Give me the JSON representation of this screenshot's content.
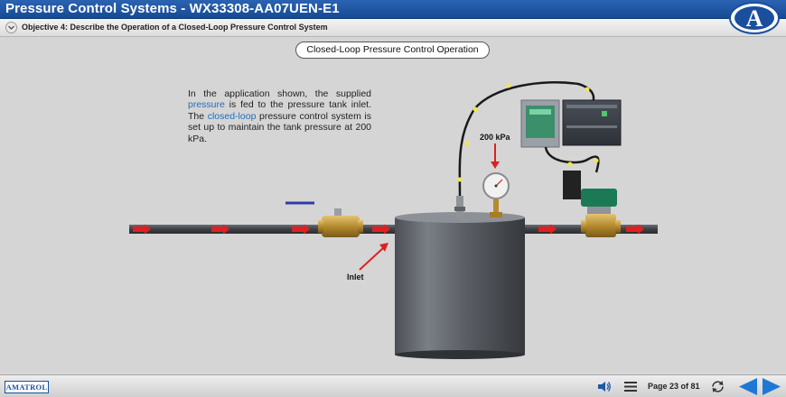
{
  "window": {
    "title": "Pressure Control Systems - WX33308-AA07UEN-E1",
    "logo_letter": "A"
  },
  "objective": {
    "text": "Objective 4: Describe the Operation of a Closed-Loop Pressure Control System"
  },
  "content": {
    "section_title": "Closed-Loop Pressure Control Operation",
    "description": {
      "part1": "In the application shown, the supplied ",
      "link1": "pressure",
      "part2": " is fed to the pressure tank inlet. The ",
      "link2": "closed-loop",
      "part3": " pressure control system is set up to maintain the tank pressure at 200 kPa."
    },
    "gauge_label": "200 kPa",
    "inlet_label": "Inlet"
  },
  "footer": {
    "brand": "AMATROL",
    "page_indicator": "Page 23 of 81"
  },
  "colors": {
    "title_bar": "#1f56a4",
    "link": "#1b6fc0",
    "nav_arrow": "#1e78d6",
    "flow_arrow": "#e02020",
    "pipe": "#4a4d52"
  },
  "icons": {
    "objective_toggle": "chevron-down-icon",
    "audio": "speaker-icon",
    "menu": "menu-icon",
    "reload": "reload-icon",
    "back": "arrow-left-icon",
    "next": "arrow-right-icon"
  }
}
